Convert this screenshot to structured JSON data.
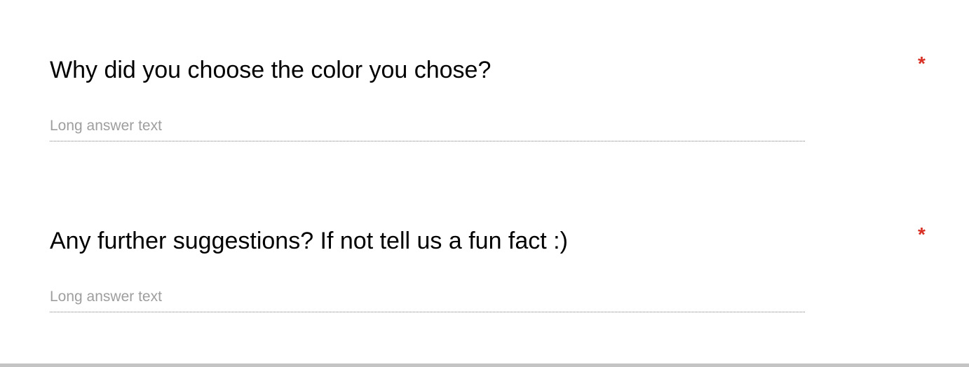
{
  "questions": [
    {
      "title": "Why did you choose the color you chose?",
      "required_marker": "*",
      "answer_placeholder": "Long answer text"
    },
    {
      "title": "Any further suggestions? If not tell us a fun fact :)",
      "required_marker": "*",
      "answer_placeholder": "Long answer text"
    }
  ],
  "colors": {
    "required": "#d93025",
    "placeholder": "#9e9e9e"
  }
}
